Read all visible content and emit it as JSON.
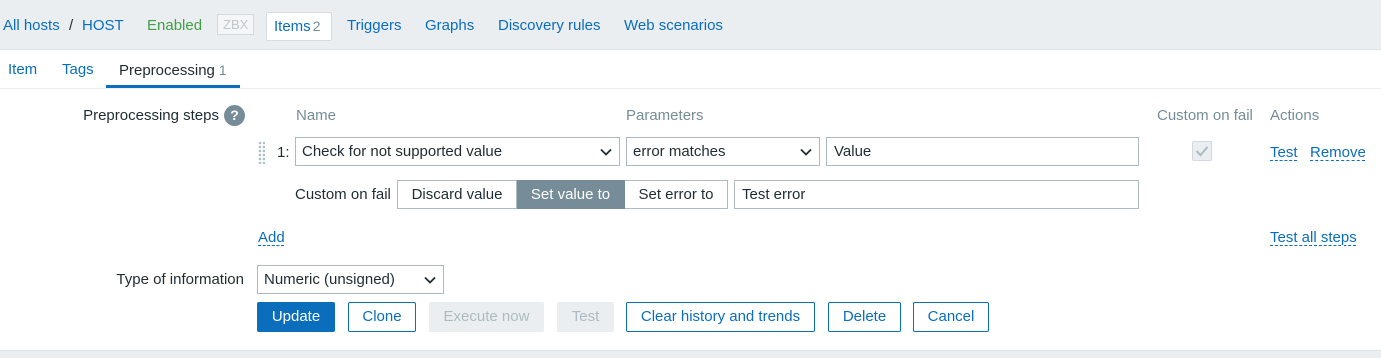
{
  "host_nav": {
    "all_hosts": "All hosts",
    "separator": "/",
    "host": "HOST",
    "status": "Enabled",
    "zbx_badge": "ZBX",
    "items_label": "Items",
    "items_count": "2",
    "triggers": "Triggers",
    "graphs": "Graphs",
    "discovery_rules": "Discovery rules",
    "web_scenarios": "Web scenarios"
  },
  "tabs": {
    "item": "Item",
    "tags": "Tags",
    "preprocessing": "Preprocessing",
    "preprocessing_count": "1"
  },
  "preprocessing": {
    "label": "Preprocessing steps",
    "help_icon": "?",
    "columns": {
      "name": "Name",
      "parameters": "Parameters",
      "custom_on_fail": "Custom on fail",
      "actions": "Actions"
    },
    "step": {
      "number": "1:",
      "name": "Check for not supported value",
      "parameter_select": "error matches",
      "parameter_value": "Value",
      "custom_on_fail_checked": true,
      "test": "Test",
      "remove": "Remove"
    },
    "custom_on_fail": {
      "label": "Custom on fail",
      "options": [
        "Discard value",
        "Set value to",
        "Set error to"
      ],
      "selected": "Set value to",
      "value": "Test error"
    },
    "add": "Add",
    "test_all": "Test all steps"
  },
  "type_of_information": {
    "label": "Type of information",
    "value": "Numeric (unsigned)"
  },
  "buttons": {
    "update": "Update",
    "clone": "Clone",
    "execute_now": "Execute now",
    "test": "Test",
    "clear_history": "Clear history and trends",
    "delete": "Delete",
    "cancel": "Cancel"
  },
  "colors": {
    "link": "#0a6ebd",
    "enabled": "#429e47",
    "selected_segment": "#768d99"
  },
  "icons": {
    "help": "question-circle-icon",
    "drag": "drag-handle-icon",
    "dropdown": "chevron-down-icon",
    "check": "check-icon"
  }
}
